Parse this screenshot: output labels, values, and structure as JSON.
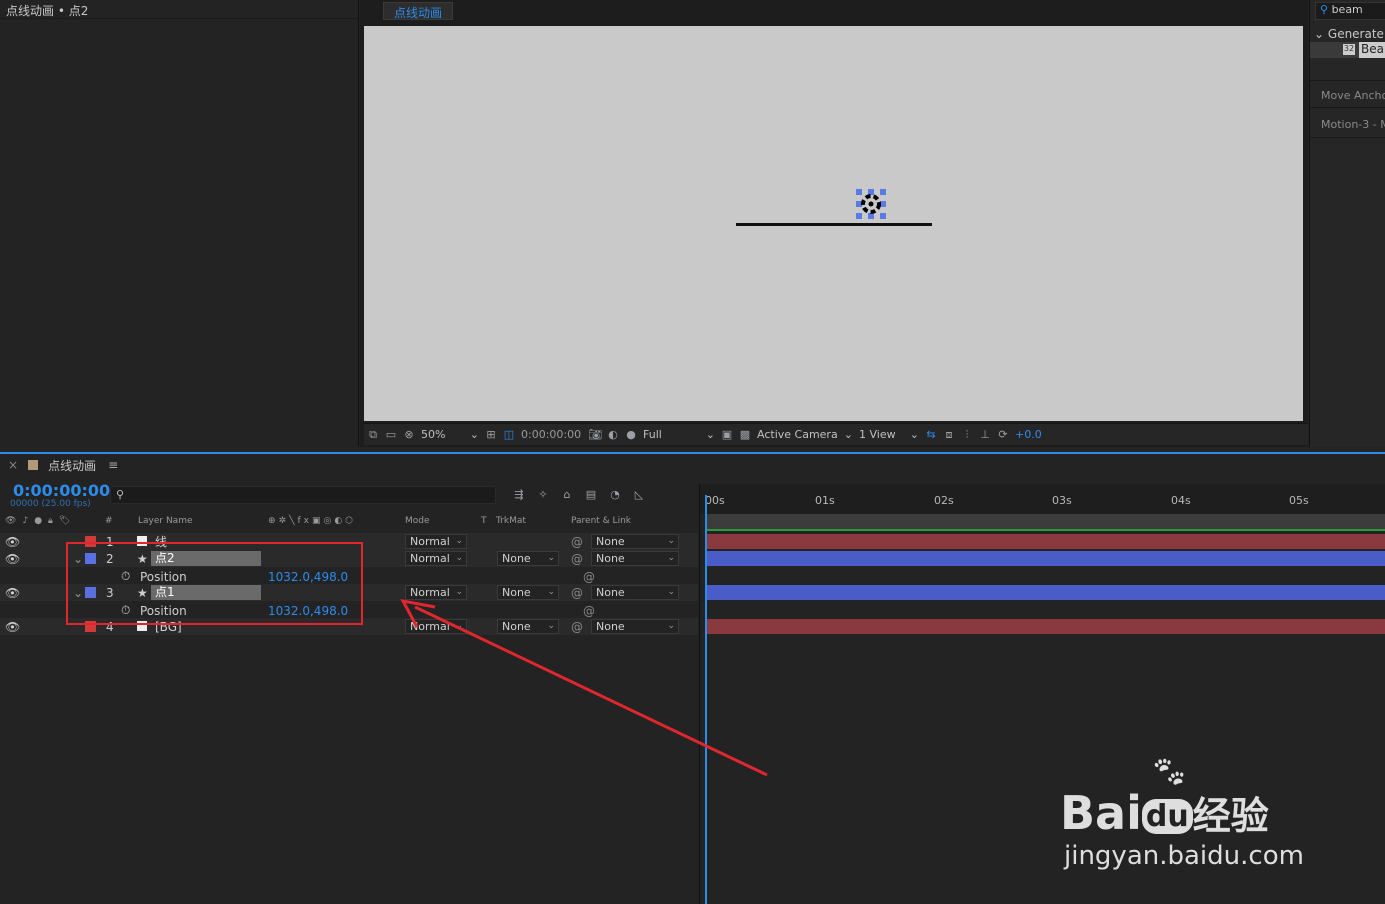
{
  "project": {
    "title": "点线动画 • 点2"
  },
  "viewer": {
    "tab": "点线动画",
    "zoom": "50%",
    "timecode": "0:00:00:00",
    "resolution": "Full",
    "camera": "Active Camera",
    "views": "1 View",
    "exposure": "+0.0"
  },
  "effects": {
    "search": "beam",
    "category": "Generate",
    "item": "Bea",
    "preset1": "Move Anchor",
    "preset2": "Motion-3 - M"
  },
  "timeline": {
    "tab": "点线动画",
    "timecode": "0:00:00:00",
    "fps": "00000 (25.00 fps)",
    "columns": {
      "hash": "#",
      "layer_name": "Layer Name",
      "mode": "Mode",
      "t": "T",
      "trkmat": "TrkMat",
      "parent": "Parent & Link"
    },
    "ruler": [
      "00s",
      "01s",
      "02s",
      "03s",
      "04s",
      "05s"
    ],
    "layers": [
      {
        "num": "1",
        "name": "线",
        "mode": "Normal",
        "trkmat": "",
        "parent": "None",
        "color": "#d23a3a"
      },
      {
        "num": "2",
        "name": "点2",
        "mode": "Normal",
        "trkmat": "None",
        "parent": "None",
        "color": "#5a6fe0",
        "prop": "Position",
        "value": "1032.0,498.0"
      },
      {
        "num": "3",
        "name": "点1",
        "mode": "Normal",
        "trkmat": "None",
        "parent": "None",
        "color": "#5a6fe0",
        "prop": "Position",
        "value": "1032.0,498.0"
      },
      {
        "num": "4",
        "name": "[BG]",
        "mode": "Normal",
        "trkmat": "None",
        "parent": "None",
        "color": "#d23a3a"
      }
    ]
  },
  "watermark": {
    "brand_bai": "Bai",
    "brand_du": "du",
    "brand_cn": "经验",
    "url": "jingyan.baidu.com"
  }
}
